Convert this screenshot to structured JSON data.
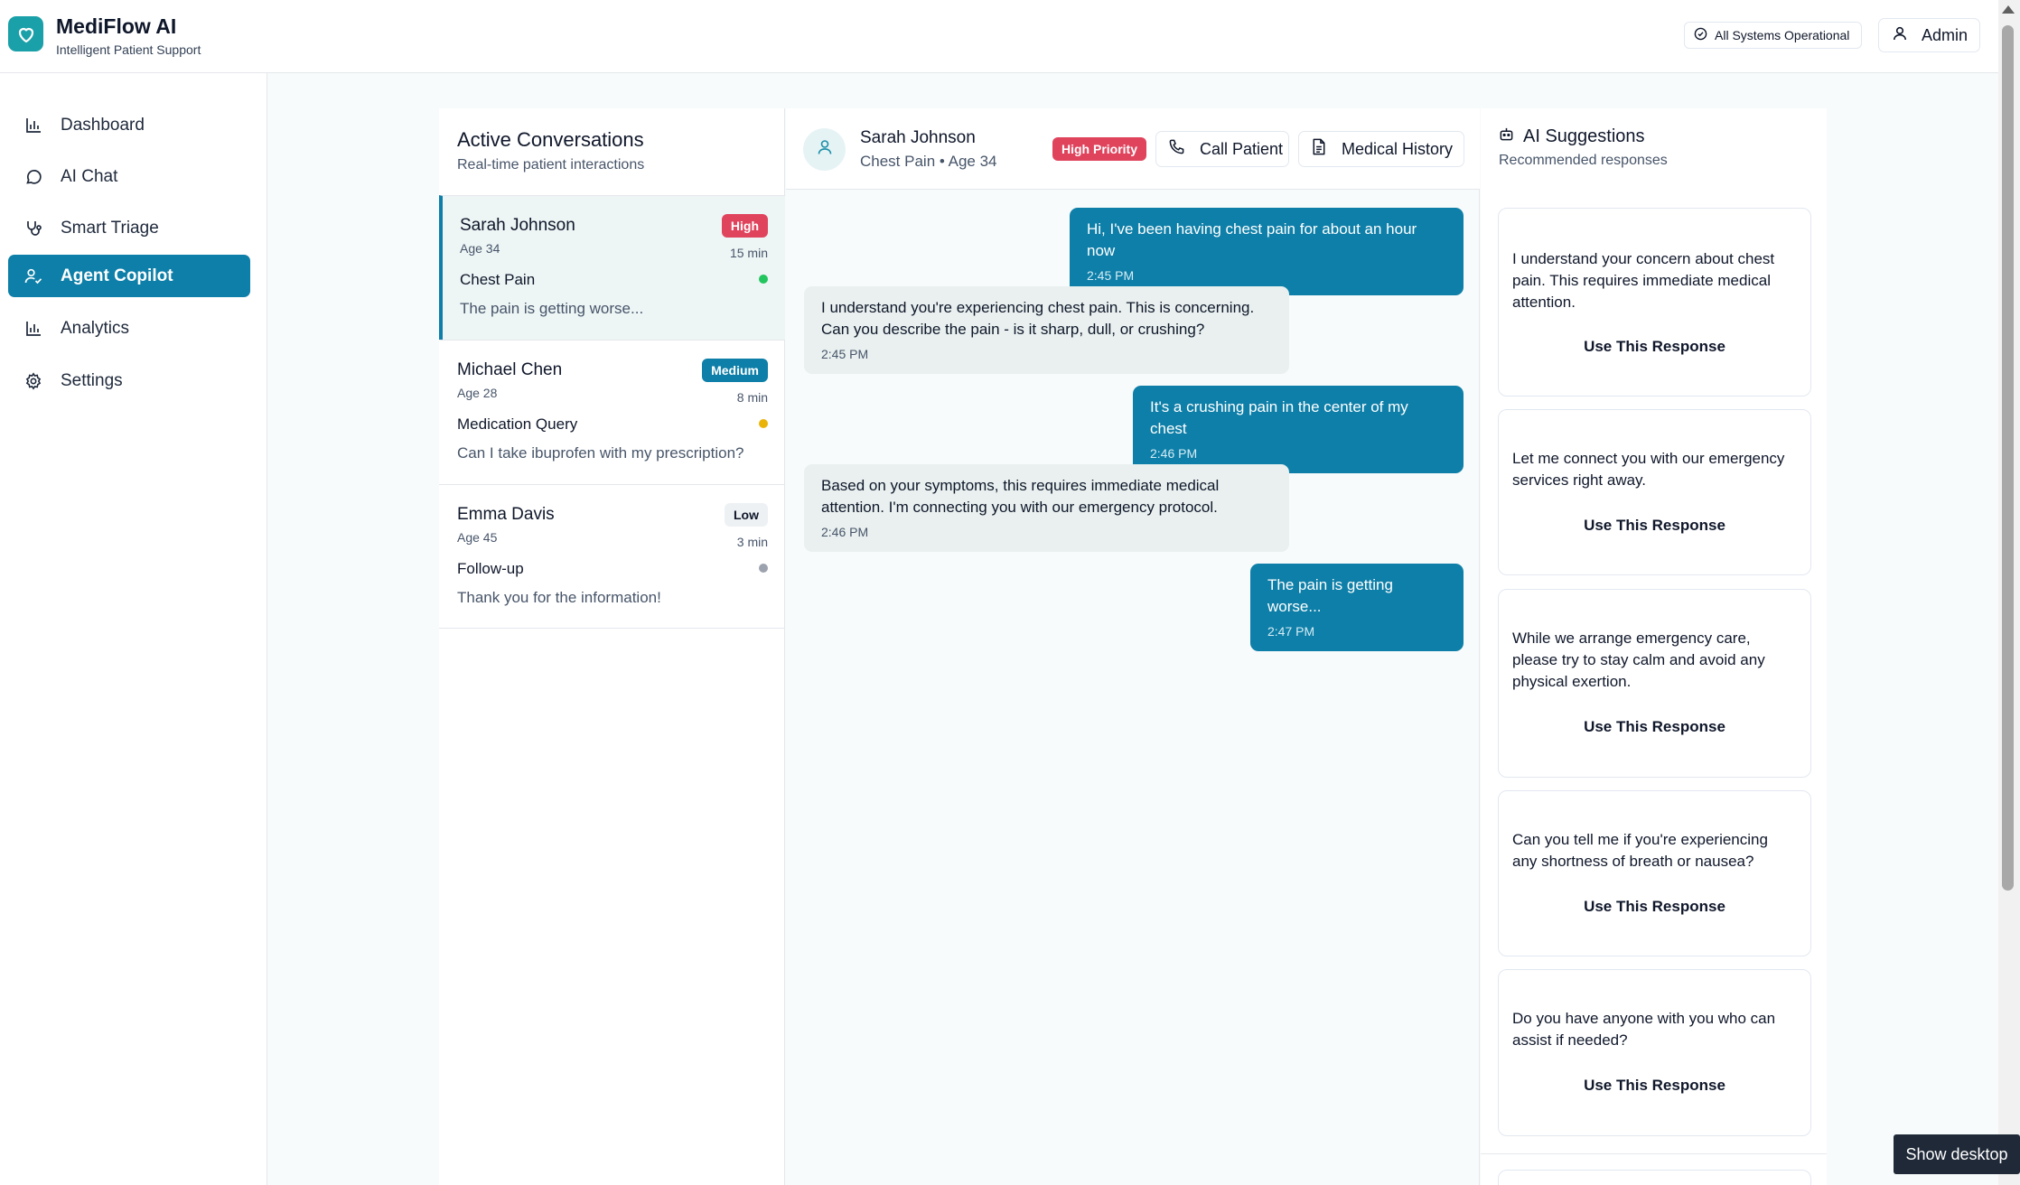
{
  "app": {
    "name": "MediFlow AI",
    "subtitle": "Intelligent Patient Support",
    "status": "All Systems Operational",
    "user": "Admin"
  },
  "sidebar": {
    "items": [
      {
        "label": "Dashboard",
        "icon": "bar-chart-icon",
        "active": false
      },
      {
        "label": "AI Chat",
        "icon": "chat-bubble-icon",
        "active": false
      },
      {
        "label": "Smart Triage",
        "icon": "stethoscope-icon",
        "active": false
      },
      {
        "label": "Agent Copilot",
        "icon": "user-check-icon",
        "active": true
      },
      {
        "label": "Analytics",
        "icon": "bar-chart-icon",
        "active": false
      },
      {
        "label": "Settings",
        "icon": "gear-icon",
        "active": false
      }
    ]
  },
  "conversations": {
    "title": "Active Conversations",
    "subtitle": "Real-time patient interactions",
    "items": [
      {
        "name": "Sarah Johnson",
        "age": "Age 34",
        "priority": "High",
        "time": "15 min",
        "topic": "Chest Pain",
        "last_message": "The pain is getting worse...",
        "status_color": "#22c55e"
      },
      {
        "name": "Michael Chen",
        "age": "Age 28",
        "priority": "Medium",
        "time": "8 min",
        "topic": "Medication Query",
        "last_message": "Can I take ibuprofen with my prescription?",
        "status_color": "#eab308"
      },
      {
        "name": "Emma Davis",
        "age": "Age 45",
        "priority": "Low",
        "time": "3 min",
        "topic": "Follow-up",
        "last_message": "Thank you for the information!",
        "status_color": "#9ca3af"
      }
    ]
  },
  "chat": {
    "patient_name": "Sarah Johnson",
    "patient_meta": "Chest Pain • Age 34",
    "priority_label": "High Priority",
    "call_label": "Call Patient",
    "history_label": "Medical History",
    "messages": [
      {
        "direction": "out",
        "text": "Hi, I've been having chest pain for about an hour now",
        "time": "2:45 PM"
      },
      {
        "direction": "in",
        "text": "I understand you're experiencing chest pain. This is concerning. Can you describe the pain - is it sharp, dull, or crushing?",
        "time": "2:45 PM"
      },
      {
        "direction": "out",
        "text": "It's a crushing pain in the center of my chest",
        "time": "2:46 PM"
      },
      {
        "direction": "in",
        "text": "Based on your symptoms, this requires immediate medical attention. I'm connecting you with our emergency protocol.",
        "time": "2:46 PM"
      },
      {
        "direction": "out",
        "text": "The pain is getting worse...",
        "time": "2:47 PM"
      }
    ]
  },
  "suggestions": {
    "title": "AI Suggestions",
    "subtitle": "Recommended responses",
    "use_label": "Use This Response",
    "items": [
      "I understand your concern about chest pain. This requires immediate medical attention.",
      "Let me connect you with our emergency services right away.",
      "While we arrange emergency care, please try to stay calm and avoid any physical exertion.",
      "Can you tell me if you're experiencing any shortness of breath or nausea?",
      "Do you have anyone with you who can assist if needed?"
    ]
  },
  "taskbar": {
    "show_desktop": "Show desktop"
  },
  "colors": {
    "accent": "#0e7fa8",
    "brand": "#1aa0a8",
    "high": "#e0445d",
    "medium": "#0e7fa8",
    "low": "#eef1f4"
  }
}
